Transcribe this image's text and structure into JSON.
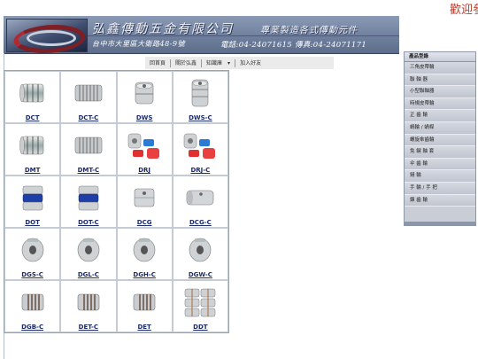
{
  "marquee": "歡迎參",
  "header": {
    "company": "弘鑫傳動五金有限公司",
    "slogan": "專業製造各式傳動元件",
    "address": "台中市大里區大衛路48-9號",
    "tel": "電話:04-24071615  傳真:04-24071171"
  },
  "topnav": [
    {
      "label": "回首頁"
    },
    {
      "label": "關於弘鑫"
    },
    {
      "label": "知識庫"
    },
    {
      "label": "加入好友"
    }
  ],
  "products": [
    {
      "code": "DCT",
      "icon": "coupling-slit"
    },
    {
      "code": "DCT-C",
      "icon": "coupling-slit-long"
    },
    {
      "code": "DWS",
      "icon": "coupling-clamp"
    },
    {
      "code": "DWS-C",
      "icon": "coupling-clamp-long"
    },
    {
      "code": "DMT",
      "icon": "coupling-slit"
    },
    {
      "code": "DMT-C",
      "icon": "coupling-slit-long"
    },
    {
      "code": "DRJ",
      "icon": "jaw-coupling-parts"
    },
    {
      "code": "DRJ-C",
      "icon": "jaw-coupling-parts"
    },
    {
      "code": "DOT",
      "icon": "oldham-coupling"
    },
    {
      "code": "DOT-C",
      "icon": "oldham-coupling"
    },
    {
      "code": "DCG",
      "icon": "rigid-coupling"
    },
    {
      "code": "DCG-C",
      "icon": "rigid-coupling-long"
    },
    {
      "code": "DGS-C",
      "icon": "disc-coupling"
    },
    {
      "code": "DGL-C",
      "icon": "disc-coupling"
    },
    {
      "code": "DGH-C",
      "icon": "disc-coupling"
    },
    {
      "code": "DGW-C",
      "icon": "disc-coupling"
    },
    {
      "code": "DGB-C",
      "icon": "bellows-coupling"
    },
    {
      "code": "DET-C",
      "icon": "bellows-coupling"
    },
    {
      "code": "DET",
      "icon": "bellows-coupling"
    },
    {
      "code": "DDT",
      "icon": "bellows-coupling-stack"
    }
  ],
  "sidebar": {
    "title": "產品型錄",
    "items": [
      {
        "label": "三角皮帶輪"
      },
      {
        "label": "聯 軸 器"
      },
      {
        "label": "小型聯軸器"
      },
      {
        "label": "時規皮帶輪"
      },
      {
        "label": "正 齒 輪"
      },
      {
        "label": "蝸輪 / 蝸桿"
      },
      {
        "label": "螺旋傘齒輪"
      },
      {
        "label": "免 鍵 軸 套"
      },
      {
        "label": "伞 齒 輪"
      },
      {
        "label": "鏈      輪"
      },
      {
        "label": "手 輪 / 手 把"
      },
      {
        "label": "鍊 齒 輪"
      }
    ]
  },
  "colors": {
    "header": "#6d7e9c",
    "link": "#1b2a6b",
    "accent": "#c0392b"
  }
}
